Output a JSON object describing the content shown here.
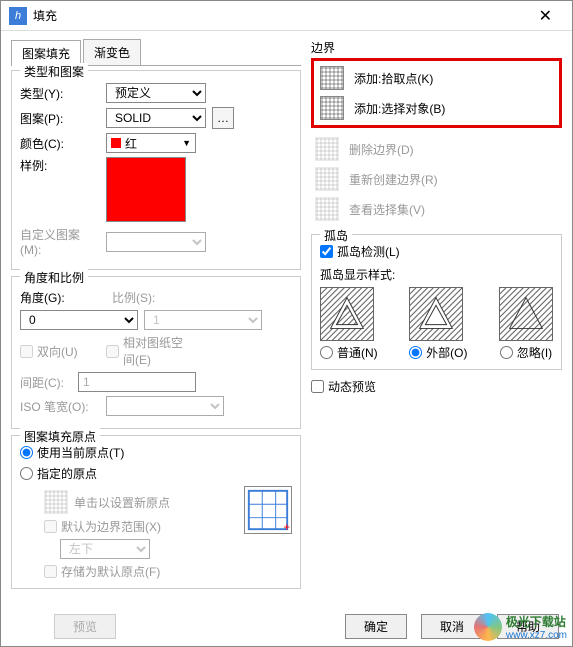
{
  "titlebar": {
    "title": "填充",
    "close": "✕"
  },
  "tabs": {
    "t1": "图案填充",
    "t2": "渐变色"
  },
  "typePattern": {
    "group": "类型和图案",
    "type_label": "类型(Y):",
    "type_value": "预定义",
    "pattern_label": "图案(P):",
    "pattern_value": "SOLID",
    "color_label": "颜色(C):",
    "color_text": "红",
    "sample_label": "样例:",
    "custom_label": "自定义图案(M):"
  },
  "angleScale": {
    "group": "角度和比例",
    "angle_label": "角度(G):",
    "angle_value": "0",
    "scale_label": "比例(S):",
    "scale_value": "1",
    "bidir": "双向(U)",
    "paper": "相对图纸空间(E)",
    "spacing_label": "间距(C):",
    "spacing_value": "1",
    "iso_label": "ISO 笔宽(O):"
  },
  "origin": {
    "group": "图案填充原点",
    "use_current": "使用当前原点(T)",
    "specified": "指定的原点",
    "click_set": "单击以设置新原点",
    "default_extent": "默认为边界范围(X)",
    "pos_value": "左下",
    "store": "存储为默认原点(F)"
  },
  "boundary": {
    "group": "边界",
    "pick": "添加:拾取点(K)",
    "select": "添加:选择对象(B)",
    "remove": "删除边界(D)",
    "recreate": "重新创建边界(R)",
    "view": "查看选择集(V)"
  },
  "island": {
    "group": "孤岛",
    "detect": "孤岛检测(L)",
    "style_label": "孤岛显示样式:",
    "normal": "普通(N)",
    "outer": "外部(O)",
    "ignore": "忽略(I)"
  },
  "dynamic_preview": "动态预览",
  "footer": {
    "preview": "预览",
    "ok": "确定",
    "cancel": "取消",
    "help": "帮助"
  },
  "watermark": {
    "name": "极光下载站",
    "url": "www.xz7.com"
  }
}
